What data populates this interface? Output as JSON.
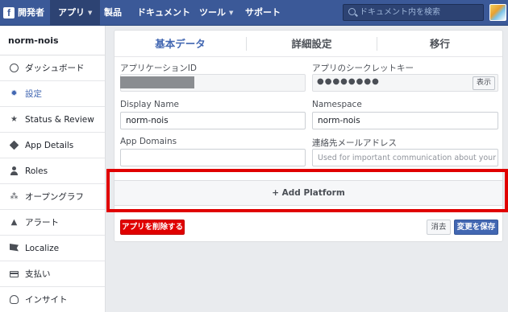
{
  "topbar": {
    "logo": "f",
    "brand": "開発者",
    "nav": [
      {
        "label": "アプリ",
        "has_caret": true,
        "active": true
      },
      {
        "label": "製品",
        "has_caret": false
      },
      {
        "label": "ドキュメント",
        "has_caret": false
      },
      {
        "label": "ツール",
        "has_caret": true
      },
      {
        "label": "サポート",
        "has_caret": false
      }
    ],
    "search_placeholder": "ドキュメント内を検索"
  },
  "sidebar": {
    "app_name": "norm-nois",
    "items": [
      {
        "label": "ダッシュボード",
        "icon": "dashboard-icon"
      },
      {
        "label": "設定",
        "icon": "gear-icon",
        "active": true
      },
      {
        "label": "Status & Review",
        "icon": "star-icon"
      },
      {
        "label": "App Details",
        "icon": "cube-icon"
      },
      {
        "label": "Roles",
        "icon": "user-icon"
      },
      {
        "label": "オープングラフ",
        "icon": "graph-icon"
      },
      {
        "label": "アラート",
        "icon": "alert-icon"
      },
      {
        "label": "Localize",
        "icon": "flag-icon"
      },
      {
        "label": "支払い",
        "icon": "card-icon"
      },
      {
        "label": "インサイト",
        "icon": "bulb-icon"
      }
    ]
  },
  "tabs": [
    {
      "label": "基本データ",
      "active": true
    },
    {
      "label": "詳細設定"
    },
    {
      "label": "移行"
    }
  ],
  "form": {
    "app_id_label": "アプリケーションID",
    "app_secret_label": "アプリのシークレットキー",
    "app_secret_masked": "●●●●●●●●",
    "show_button": "表示",
    "display_name_label": "Display Name",
    "display_name_value": "norm-nois",
    "namespace_label": "Namespace",
    "namespace_value": "norm-nois",
    "app_domains_label": "App Domains",
    "app_domains_value": "",
    "contact_email_label": "連絡先メールアドレス",
    "contact_email_placeholder": "Used for important communication about your app"
  },
  "add_platform": "+ Add Platform",
  "actions": {
    "delete": "アプリを削除する",
    "cancel": "消去",
    "save": "変更を保存"
  },
  "colors": {
    "topbar": "#3b5998",
    "accent": "#4267b2",
    "danger": "#e00000"
  }
}
